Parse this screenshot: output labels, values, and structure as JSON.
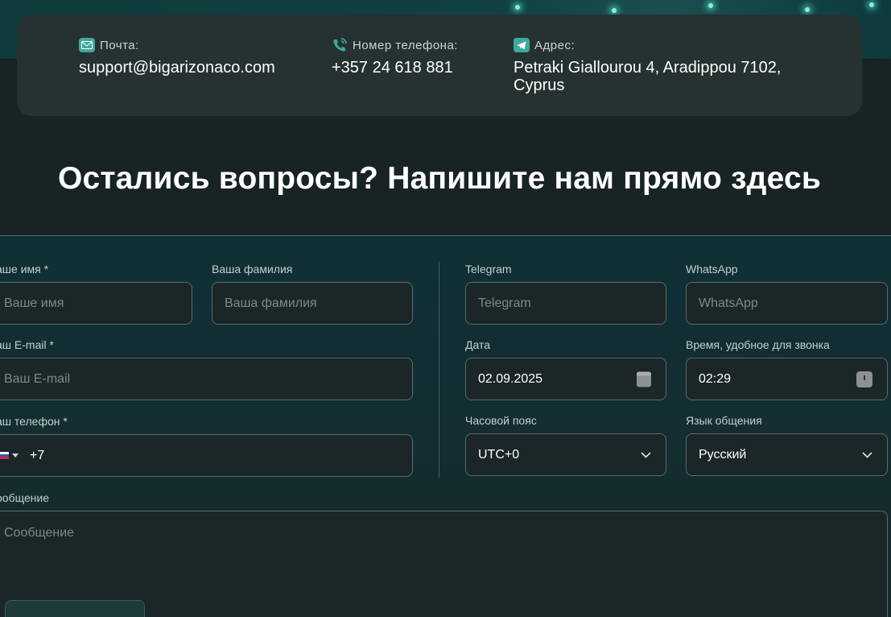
{
  "contacts": {
    "email": {
      "label": "Почта:",
      "value": "support@bigarizonaco.com",
      "icon": "mail-icon"
    },
    "phone": {
      "label": "Номер телефона:",
      "value": "+357 24 618 881",
      "icon": "phone-icon"
    },
    "address": {
      "label": "Адрес:",
      "value_line1": "Petraki Giallourou 4, Aradippou 7102,",
      "value_line2": "Cyprus",
      "icon": "telegram-icon"
    }
  },
  "section": {
    "title": "Остались вопросы? Напишите нам прямо здесь"
  },
  "form": {
    "first_name": {
      "label": "аше имя *",
      "placeholder": "Ваше имя"
    },
    "last_name": {
      "label": "Ваша фамилия",
      "placeholder": "Ваша фамилия"
    },
    "email": {
      "label": "аш E-mail *",
      "placeholder": "Ваш E-mail"
    },
    "phone": {
      "label": "аш телефон *",
      "value": "+7",
      "country": "RU"
    },
    "telegram": {
      "label": "Telegram",
      "placeholder": "Telegram"
    },
    "whatsapp": {
      "label": "WhatsApp",
      "placeholder": "WhatsApp"
    },
    "date": {
      "label": "Дата",
      "value": "02.09.2025"
    },
    "time": {
      "label": "Время, удобное для звонка",
      "value": "02:29"
    },
    "timezone": {
      "label": "Часовой пояс",
      "value": "UTC+0"
    },
    "language": {
      "label": "Язык общения",
      "value": "Русский"
    },
    "message": {
      "label": "ообщение",
      "placeholder": "Сообщение"
    }
  },
  "colors": {
    "accent": "#3fa99d",
    "background": "#172324",
    "card": "#263231"
  }
}
